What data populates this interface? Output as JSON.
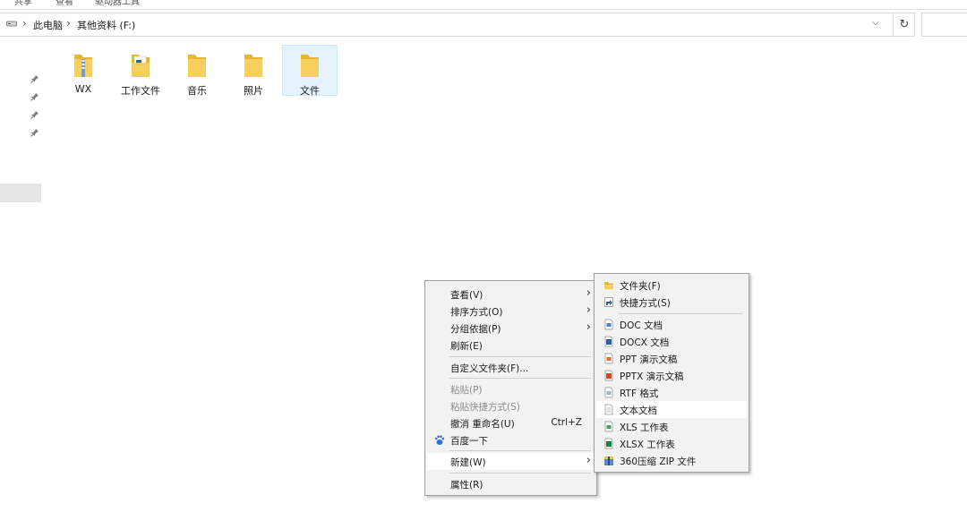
{
  "ribbon": {
    "tabs": [
      "共享",
      "查看",
      "驱动器工具"
    ]
  },
  "address": {
    "drive_icon": "drive-icon",
    "breadcrumbs": [
      "此电脑",
      "其他资料 (F:)"
    ],
    "dropdown_glyph": "⌵",
    "refresh_glyph": "↻"
  },
  "folders": [
    {
      "label": "WX",
      "type": "zip-folder"
    },
    {
      "label": "工作文件",
      "type": "doc-folder"
    },
    {
      "label": "音乐",
      "type": "folder"
    },
    {
      "label": "照片",
      "type": "folder"
    },
    {
      "label": "文件",
      "type": "folder",
      "selected": true
    }
  ],
  "context_menu": {
    "items": [
      {
        "label": "查看(V)",
        "submenu": true
      },
      {
        "label": "排序方式(O)",
        "submenu": true
      },
      {
        "label": "分组依据(P)",
        "submenu": true
      },
      {
        "label": "刷新(E)"
      },
      {
        "label": "自定义文件夹(F)..."
      },
      {
        "label": "粘贴(P)",
        "disabled": true
      },
      {
        "label": "粘贴快捷方式(S)",
        "disabled": true
      },
      {
        "label": "撤消 重命名(U)",
        "shortcut": "Ctrl+Z"
      },
      {
        "label": "百度一下",
        "icon": "baidu-paw-icon"
      },
      {
        "label": "新建(W)",
        "submenu": true,
        "highlighted": true
      },
      {
        "label": "属性(R)"
      }
    ]
  },
  "new_submenu": {
    "items": [
      {
        "label": "文件夹(F)",
        "icon": "folder-icon"
      },
      {
        "label": "快捷方式(S)",
        "icon": "shortcut-icon"
      },
      {
        "label": "DOC 文档",
        "icon": "doc-icon"
      },
      {
        "label": "DOCX 文档",
        "icon": "docx-icon"
      },
      {
        "label": "PPT 演示文稿",
        "icon": "ppt-icon"
      },
      {
        "label": "PPTX 演示文稿",
        "icon": "pptx-icon"
      },
      {
        "label": "RTF 格式",
        "icon": "rtf-icon"
      },
      {
        "label": "文本文档",
        "icon": "text-document-icon",
        "highlighted": true
      },
      {
        "label": "XLS 工作表",
        "icon": "xls-icon"
      },
      {
        "label": "XLSX 工作表",
        "icon": "xlsx-icon"
      },
      {
        "label": "360压缩 ZIP 文件",
        "icon": "zip-archive-icon"
      }
    ]
  }
}
